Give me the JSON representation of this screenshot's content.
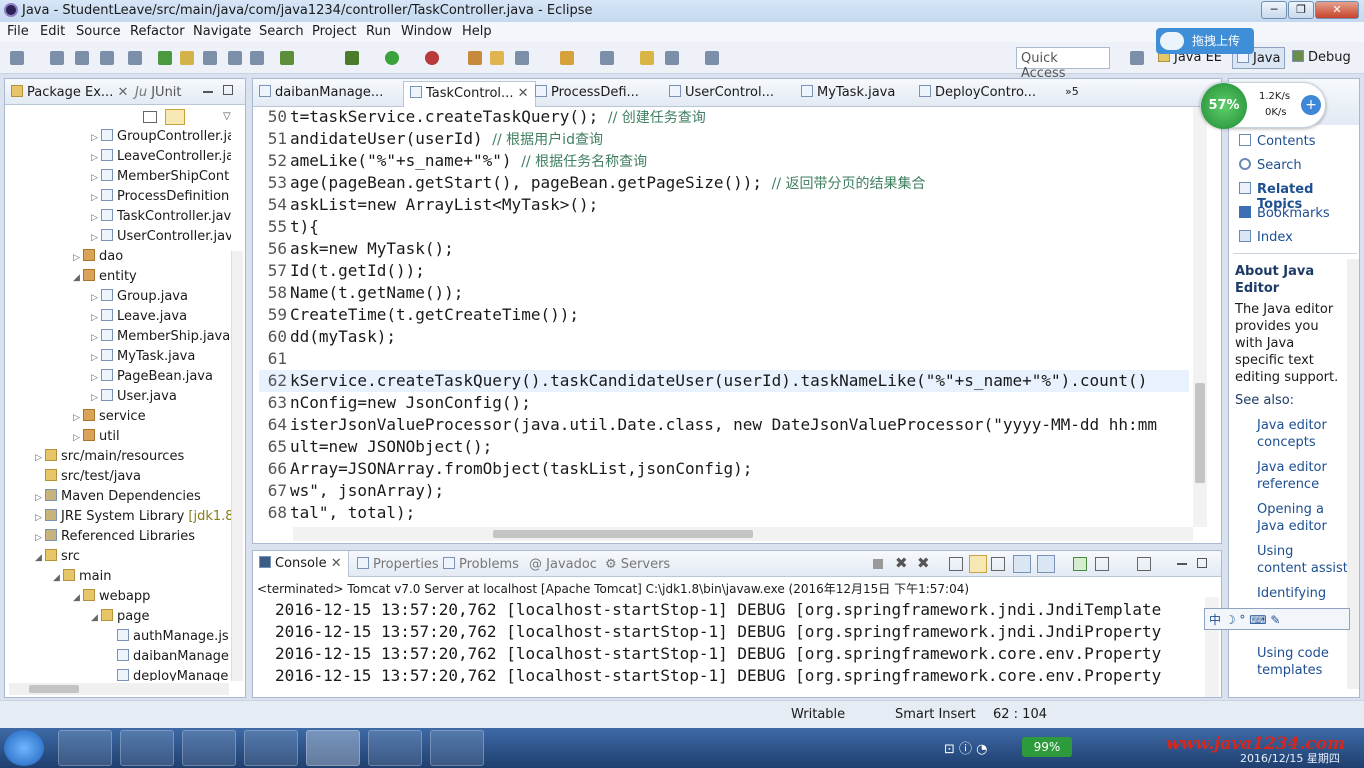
{
  "window": {
    "title": "Java - StudentLeave/src/main/java/com/java1234/controller/TaskController.java - Eclipse"
  },
  "menu": [
    "File",
    "Edit",
    "Source",
    "Refactor",
    "Navigate",
    "Search",
    "Project",
    "Run",
    "Window",
    "Help"
  ],
  "toolbar": {
    "quick_access": "Quick Access",
    "perspectives": [
      "Java EE",
      "Java",
      "Debug"
    ],
    "upload_badge": "拖拽上传"
  },
  "package_explorer": {
    "tabs": [
      "Package Ex...",
      "JUnit"
    ],
    "items": [
      "GroupController.ja",
      "LeaveController.ja",
      "MemberShipCont",
      "ProcessDefinition",
      "TaskController.jav",
      "UserController.jav",
      "dao",
      "entity",
      "Group.java",
      "Leave.java",
      "MemberShip.java",
      "MyTask.java",
      "PageBean.java",
      "User.java",
      "service",
      "util",
      "src/main/resources",
      "src/test/java",
      "Maven Dependencies",
      "JRE System Library",
      "Referenced Libraries",
      "src",
      "main",
      "webapp",
      "page",
      "authManage.js",
      "daibanManage",
      "deployManage"
    ],
    "jre_version": "[jdk1.8]"
  },
  "editor": {
    "tabs": [
      "daibanManage...",
      "TaskControl...",
      "ProcessDefi...",
      "UserControl...",
      "MyTask.java",
      "DeployContro...",
      "5"
    ]
  },
  "code_lines": [
    {
      "n": "50",
      "pre": "t=taskService.createTaskQuery(); ",
      "cm": "// 创建任务查询"
    },
    {
      "n": "51",
      "pre": "andidateUser(userId) ",
      "cm": "// 根据用户id查询"
    },
    {
      "n": "52",
      "pre": "ameLike(\"%\"+s_name+\"%\") ",
      "cm": "// 根据任务名称查询"
    },
    {
      "n": "53",
      "pre": "age(pageBean.getStart(), pageBean.getPageSize()); ",
      "cm": "// 返回带分页的结果集合"
    },
    {
      "n": "54",
      "pre": "askList=new ArrayList<MyTask>();",
      "cm": ""
    },
    {
      "n": "55",
      "pre": "t){",
      "cm": ""
    },
    {
      "n": "56",
      "pre": "ask=new MyTask();",
      "cm": ""
    },
    {
      "n": "57",
      "pre": "Id(t.getId());",
      "cm": ""
    },
    {
      "n": "58",
      "pre": "Name(t.getName());",
      "cm": ""
    },
    {
      "n": "59",
      "pre": "CreateTime(t.getCreateTime());",
      "cm": ""
    },
    {
      "n": "60",
      "pre": "dd(myTask);",
      "cm": ""
    },
    {
      "n": "61",
      "pre": "",
      "cm": ""
    },
    {
      "n": "62",
      "pre": "kService.createTaskQuery().taskCandidateUser(userId).taskNameLike(\"%\"+s_name+\"%\").count()",
      "cm": ""
    },
    {
      "n": "63",
      "pre": "nConfig=new JsonConfig();",
      "cm": ""
    },
    {
      "n": "64",
      "pre": "isterJsonValueProcessor(java.util.Date.class, new DateJsonValueProcessor(\"yyyy-MM-dd hh:mm",
      "cm": ""
    },
    {
      "n": "65",
      "pre": "ult=new JSONObject();",
      "cm": ""
    },
    {
      "n": "66",
      "pre": "Array=JSONArray.fromObject(taskList,jsonConfig);",
      "cm": ""
    },
    {
      "n": "67",
      "pre": "ws\", jsonArray);",
      "cm": ""
    },
    {
      "n": "68",
      "pre": "tal\", total);",
      "cm": ""
    }
  ],
  "console": {
    "tabs": [
      "Console",
      "Properties",
      "Problems",
      "Javadoc",
      "Servers"
    ],
    "status": "<terminated> Tomcat v7.0 Server at localhost [Apache Tomcat] C:\\jdk1.8\\bin\\javaw.exe (2016年12月15日 下午1:57:04)",
    "lines": [
      "2016-12-15 13:57:20,762 [localhost-startStop-1] DEBUG [org.springframework.jndi.JndiTemplate",
      "2016-12-15 13:57:20,762 [localhost-startStop-1] DEBUG [org.springframework.jndi.JndiProperty",
      "2016-12-15 13:57:20,762 [localhost-startStop-1] DEBUG [org.springframework.core.env.Property",
      "2016-12-15 13:57:20,762 [localhost-startStop-1] DEBUG [org.springframework.core.env.Property"
    ]
  },
  "help": {
    "links": [
      "Contents",
      "Search",
      "Related Topics",
      "Bookmarks",
      "Index"
    ],
    "about_title": "About Java Editor",
    "about_text": [
      "The Java editor",
      "provides you",
      "with Java",
      "specific text",
      "editing support."
    ],
    "see_also": "See also:",
    "refs": [
      "Java editor",
      "concepts",
      "Java editor",
      "reference",
      "Opening a",
      "Java editor",
      "Using",
      "content assist",
      "Identifying",
      "Using code",
      "templates"
    ]
  },
  "network": {
    "cpu": "57%",
    "up": "1.2K/s",
    "down": "0K/s"
  },
  "status": {
    "writable": "Writable",
    "insert": "Smart Insert",
    "pos": "62 : 104"
  },
  "taskbar": {
    "battery": "99%",
    "watermark": "www.java1234.com",
    "date": "2016/12/15 星期四"
  }
}
